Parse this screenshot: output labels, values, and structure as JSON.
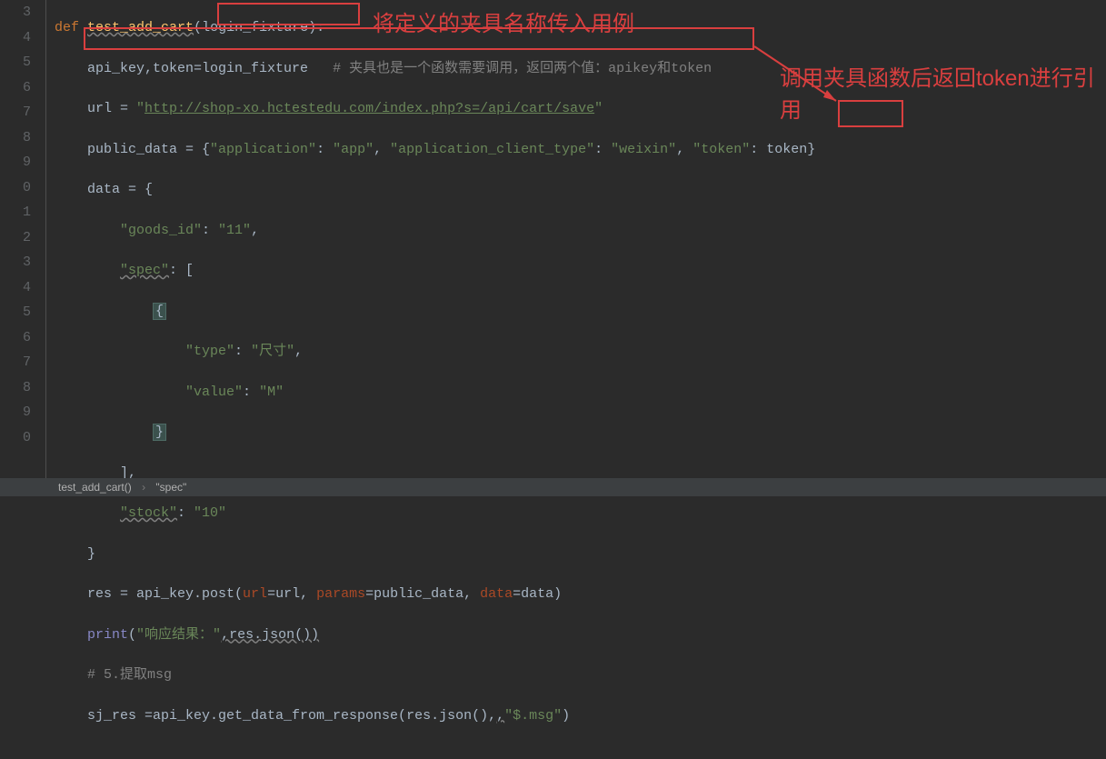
{
  "gutter": {
    "lines": [
      "3",
      "4",
      "5",
      "6",
      "7",
      "8",
      "9",
      "0",
      "1",
      "2",
      "3",
      "4",
      "5",
      "6",
      "7",
      "8",
      "9",
      "0"
    ]
  },
  "code": {
    "l1_def": "def ",
    "l1_fn": "test_add_cart",
    "l1_paren_open": "(",
    "l1_param": "login_fixture",
    "l1_paren_close": ")",
    "l1_colon": ":",
    "l2_assign": "    api_key,token=login_fixture   ",
    "l2_com": "# 夹具也是一个函数需要调用，返回两个值：apikey和token",
    "l3_prefix": "    url = ",
    "l3_q1": "\"",
    "l3_url": "http://shop-xo.hctestedu.com/index.php?s=/api/cart/save",
    "l3_q2": "\"",
    "l4_prefix": "    public_data = {",
    "l4_k1": "\"application\"",
    "l4_c1": ": ",
    "l4_v1": "\"app\"",
    "l4_c2": ", ",
    "l4_k2": "\"application_client_type\"",
    "l4_c3": ": ",
    "l4_v2": "\"weixin\"",
    "l4_c4": ", ",
    "l4_k3": "\"token\"",
    "l4_c5": ": token}",
    "l5": "    data = {",
    "l6_a": "        ",
    "l6_k": "\"goods_id\"",
    "l6_b": ": ",
    "l6_v": "\"11\"",
    "l6_c": ",",
    "l7_a": "        ",
    "l7_k": "\"spec\"",
    "l7_b": ": [",
    "l8": "            {",
    "l9_a": "                ",
    "l9_k": "\"type\"",
    "l9_b": ": ",
    "l9_v": "\"尺寸\"",
    "l9_c": ",",
    "l10_a": "                ",
    "l10_k": "\"value\"",
    "l10_b": ": ",
    "l10_v": "\"M\"",
    "l11": "            }",
    "l12": "        ],",
    "l13_a": "        ",
    "l13_k": "\"stock\"",
    "l13_b": ": ",
    "l13_v": "\"10\"",
    "l14": "    }",
    "l15_a": "    res = api_key.post(",
    "l15_p1": "url",
    "l15_b": "=url, ",
    "l15_p2": "params",
    "l15_c": "=public_data, ",
    "l15_p3": "data",
    "l15_d": "=data)",
    "l16_a": "    ",
    "l16_fn": "print",
    "l16_b": "(",
    "l16_s": "\"响应结果：\"",
    "l16_c": ",res.json())",
    "l17": "    ",
    "l17_com": "# 5.提取msg",
    "l18_a": "    sj_res =api_key.get_data_from_response(res.json(),",
    "l18_s": "\"$.msg\"",
    "l18_b": ")"
  },
  "annotations": {
    "title1": "将定义的夹具名称传入用例",
    "title2": "调用夹具函数后返回token进行引用"
  },
  "breadcrumb": {
    "item1": "test_add_cart()",
    "item2": "\"spec\""
  }
}
